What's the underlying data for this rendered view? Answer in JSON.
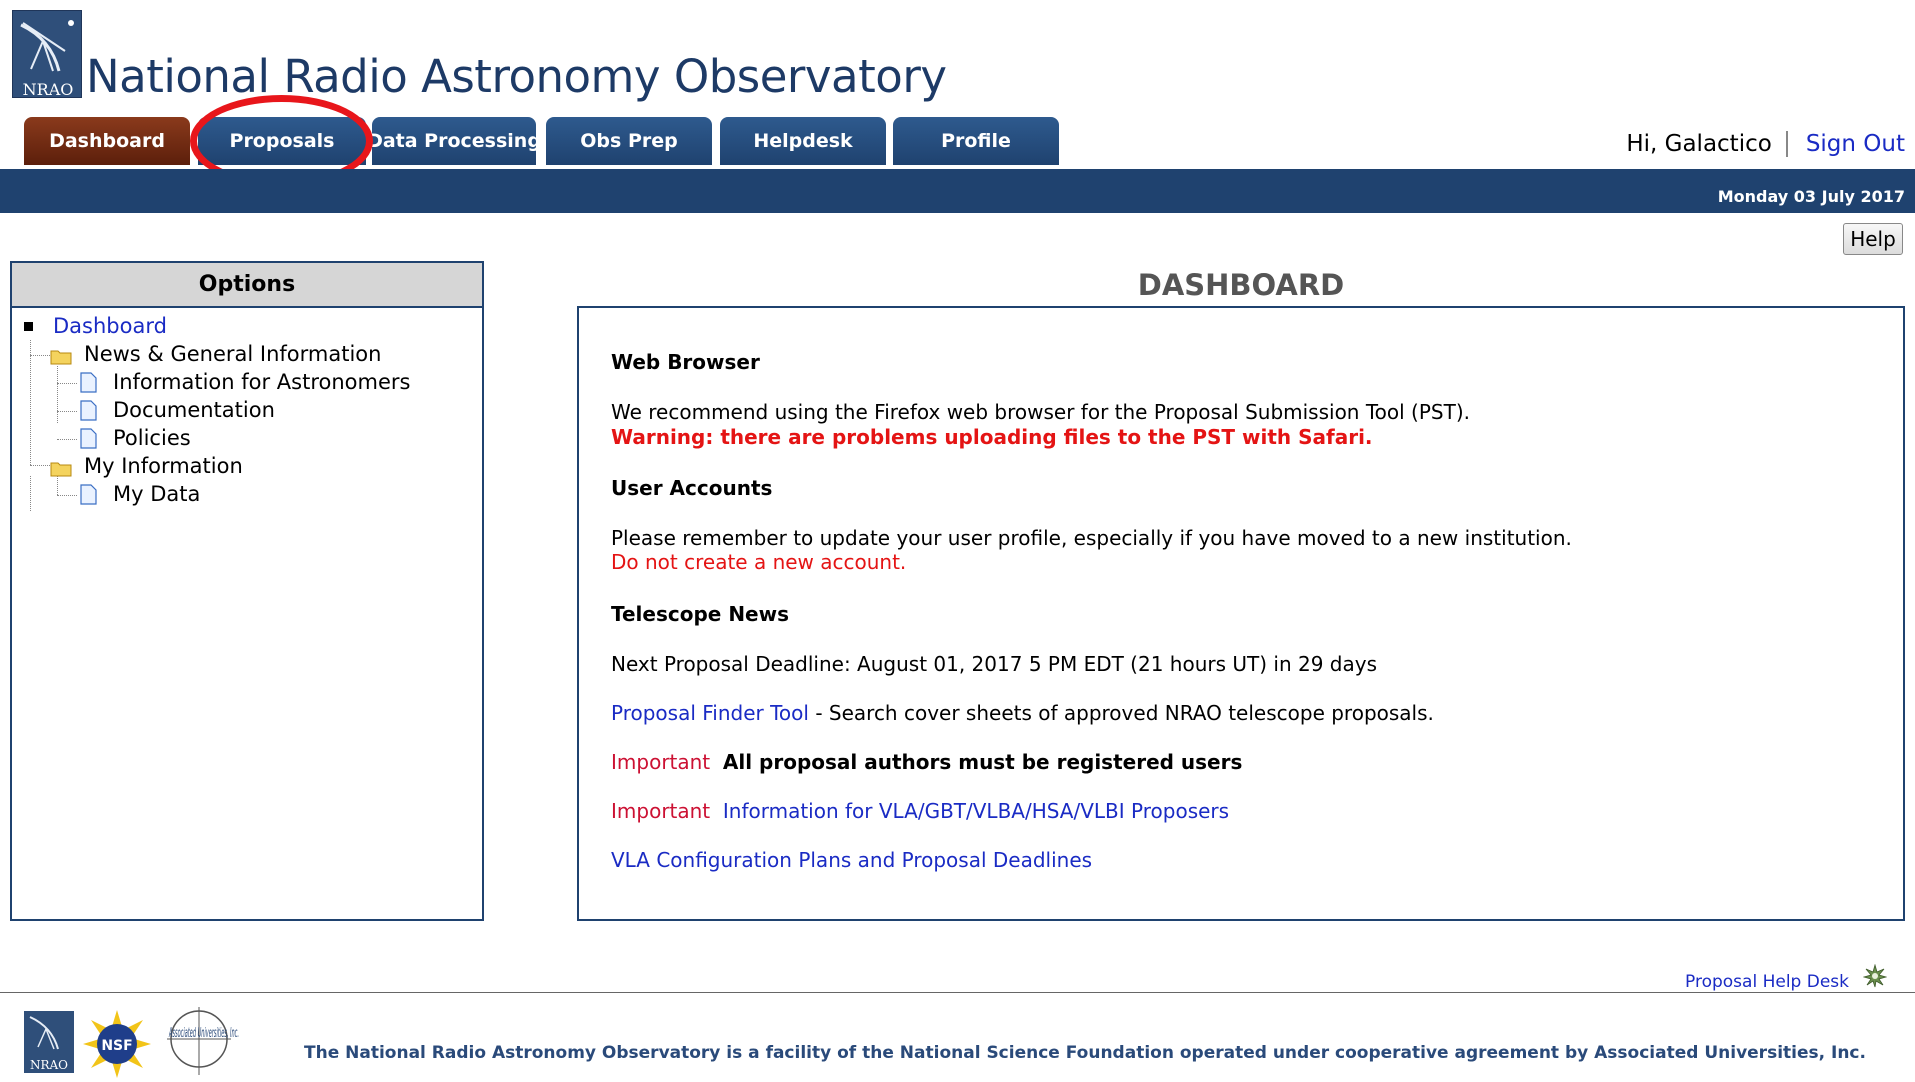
{
  "header": {
    "logo_text": "NRAO",
    "site_title": "National Radio Astronomy Observatory",
    "tabs": [
      {
        "label": "Dashboard",
        "active": true
      },
      {
        "label": "Proposals",
        "active": false
      },
      {
        "label": "Data Processing",
        "active": false
      },
      {
        "label": "Obs Prep",
        "active": false
      },
      {
        "label": "Helpdesk",
        "active": false
      },
      {
        "label": "Profile",
        "active": false
      }
    ],
    "greeting": "Hi, Galactico",
    "sign_out": "Sign Out",
    "date": "Monday 03 July 2017",
    "help_button": "Help"
  },
  "options": {
    "title": "Options",
    "tree": {
      "root": "Dashboard",
      "news_folder": "News & General Information",
      "news_items": [
        "Information for Astronomers",
        "Documentation",
        "Policies"
      ],
      "my_info_folder": "My Information",
      "my_info_items": [
        "My Data"
      ]
    }
  },
  "main": {
    "title": "DASHBOARD",
    "web_browser_heading": "Web Browser",
    "web_browser_text": "We recommend using the Firefox web browser for the Proposal Submission Tool (PST).",
    "web_browser_warning": "Warning: there are problems uploading files to the PST with Safari.",
    "user_accounts_heading": "User Accounts",
    "user_accounts_text": "Please remember to update your user profile, especially if you have moved to a new institution.",
    "user_accounts_warning": "Do not create a new account.",
    "telescope_news_heading": "Telescope News",
    "deadline_text": "Next Proposal Deadline: August 01, 2017 5 PM EDT (21 hours UT) in 29 days",
    "finder_link": "Proposal Finder Tool",
    "finder_desc": " - Search cover sheets of approved NRAO telescope proposals.",
    "important_label": "Important",
    "important_1_text": "All proposal authors must be registered users",
    "important_2_link": "Information for VLA/GBT/VLBA/HSA/VLBI Proposers",
    "vla_link": "VLA Configuration Plans and Proposal Deadlines"
  },
  "footer": {
    "help_desk_link": "Proposal Help Desk",
    "logo_nrao": "NRAO",
    "logo_nsf": "NSF",
    "logo_aui": "Associated Universities, Inc.",
    "statement": "The National Radio Astronomy Observatory is a facility of the National Science Foundation operated under cooperative agreement by Associated Universities, Inc."
  },
  "colors": {
    "brand_blue": "#1f426f",
    "active_tab": "#6e2a12",
    "link_blue": "#1a2bc4",
    "warning_red": "#e41414",
    "highlight_ring": "#e8161b"
  }
}
